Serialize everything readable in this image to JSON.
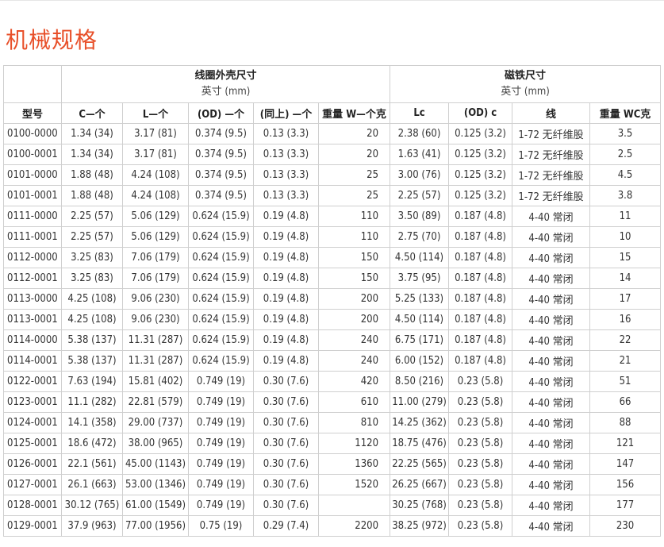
{
  "title": "机械规格",
  "coil_group": {
    "title": "线圈外壳尺寸",
    "unit": "英寸 (mm)"
  },
  "magnet_group": {
    "title": "磁铁尺寸",
    "unit": "英寸 (mm)"
  },
  "headers": [
    "型号",
    "C—个",
    "L—个",
    "(OD) —个",
    "(同上) —个",
    "重量 W—个克",
    "Lc",
    "(OD) c",
    "线",
    "重量 WC克"
  ],
  "rows": [
    [
      "0100-0000",
      "1.34 (34)",
      "3.17 (81)",
      "0.374 (9.5)",
      "0.13 (3.3)",
      "20",
      "2.38 (60)",
      "0.125 (3.2)",
      "1-72 无纤维股",
      "3.5"
    ],
    [
      "0100-0001",
      "1.34 (34)",
      "3.17 (81)",
      "0.374 (9.5)",
      "0.13 (3.3)",
      "20",
      "1.63 (41)",
      "0.125 (3.2)",
      "1-72 无纤维股",
      "2.5"
    ],
    [
      "0101-0000",
      "1.88 (48)",
      "4.24 (108)",
      "0.374 (9.5)",
      "0.13 (3.3)",
      "25",
      "3.00 (76)",
      "0.125 (3.2)",
      "1-72 无纤维股",
      "4.5"
    ],
    [
      "0101-0001",
      "1.88 (48)",
      "4.24 (108)",
      "0.374 (9.5)",
      "0.13 (3.3)",
      "25",
      "2.25 (57)",
      "0.125 (3.2)",
      "1-72 无纤维股",
      "3.8"
    ],
    [
      "0111-0000",
      "2.25 (57)",
      "5.06 (129)",
      "0.624 (15.9)",
      "0.19 (4.8)",
      "110",
      "3.50 (89)",
      "0.187 (4.8)",
      "4-40 常闭",
      "11"
    ],
    [
      "0111-0001",
      "2.25 (57)",
      "5.06 (129)",
      "0.624 (15.9)",
      "0.19 (4.8)",
      "110",
      "2.75 (70)",
      "0.187 (4.8)",
      "4-40 常闭",
      "10"
    ],
    [
      "0112-0000",
      "3.25 (83)",
      "7.06 (179)",
      "0.624 (15.9)",
      "0.19 (4.8)",
      "150",
      "4.50 (114)",
      "0.187 (4.8)",
      "4-40 常闭",
      "15"
    ],
    [
      "0112-0001",
      "3.25 (83)",
      "7.06 (179)",
      "0.624 (15.9)",
      "0.19 (4.8)",
      "150",
      "3.75 (95)",
      "0.187 (4.8)",
      "4-40 常闭",
      "14"
    ],
    [
      "0113-0000",
      "4.25 (108)",
      "9.06 (230)",
      "0.624 (15.9)",
      "0.19 (4.8)",
      "200",
      "5.25 (133)",
      "0.187 (4.8)",
      "4-40 常闭",
      "17"
    ],
    [
      "0113-0001",
      "4.25 (108)",
      "9.06 (230)",
      "0.624 (15.9)",
      "0.19 (4.8)",
      "200",
      "4.50 (114)",
      "0.187 (4.8)",
      "4-40 常闭",
      "16"
    ],
    [
      "0114-0000",
      "5.38 (137)",
      "11.31 (287)",
      "0.624 (15.9)",
      "0.19 (4.8)",
      "240",
      "6.75 (171)",
      "0.187 (4.8)",
      "4-40 常闭",
      "22"
    ],
    [
      "0114-0001",
      "5.38 (137)",
      "11.31 (287)",
      "0.624 (15.9)",
      "0.19 (4.8)",
      "240",
      "6.00 (152)",
      "0.187 (4.8)",
      "4-40 常闭",
      "21"
    ],
    [
      "0122-0001",
      "7.63 (194)",
      "15.81 (402)",
      "0.749 (19)",
      "0.30 (7.6)",
      "420",
      "8.50 (216)",
      "0.23 (5.8)",
      "4-40 常闭",
      "51"
    ],
    [
      "0123-0001",
      "11.1 (282)",
      "22.81 (579)",
      "0.749 (19)",
      "0.30 (7.6)",
      "610",
      "11.00 (279)",
      "0.23 (5.8)",
      "4-40 常闭",
      "66"
    ],
    [
      "0124-0001",
      "14.1 (358)",
      "29.00 (737)",
      "0.749 (19)",
      "0.30 (7.6)",
      "810",
      "14.25 (362)",
      "0.23 (5.8)",
      "4-40 常闭",
      "88"
    ],
    [
      "0125-0001",
      "18.6 (472)",
      "38.00 (965)",
      "0.749 (19)",
      "0.30 (7.6)",
      "1120",
      "18.75 (476)",
      "0.23 (5.8)",
      "4-40 常闭",
      "121"
    ],
    [
      "0126-0001",
      "22.1 (561)",
      "45.00 (1143)",
      "0.749 (19)",
      "0.30 (7.6)",
      "1360",
      "22.25 (565)",
      "0.23 (5.8)",
      "4-40 常闭",
      "147"
    ],
    [
      "0127-0001",
      "26.1 (663)",
      "53.00 (1346)",
      "0.749 (19)",
      "0.30 (7.6)",
      "1520",
      "26.25 (667)",
      "0.23 (5.8)",
      "4-40 常闭",
      "156"
    ],
    [
      "0128-0001",
      "30.12 (765)",
      "61.00 (1549)",
      "0.749 (19)",
      "0.30 (7.6)",
      "",
      "30.25 (768)",
      "0.23 (5.8)",
      "4-40 常闭",
      "177"
    ],
    [
      "0129-0001",
      "37.9 (963)",
      "77.00 (1956)",
      "0.75 (19)",
      "0.29 (7.4)",
      "2200",
      "38.25 (972)",
      "0.23 (5.8)",
      "4-40 常闭",
      "230"
    ]
  ]
}
